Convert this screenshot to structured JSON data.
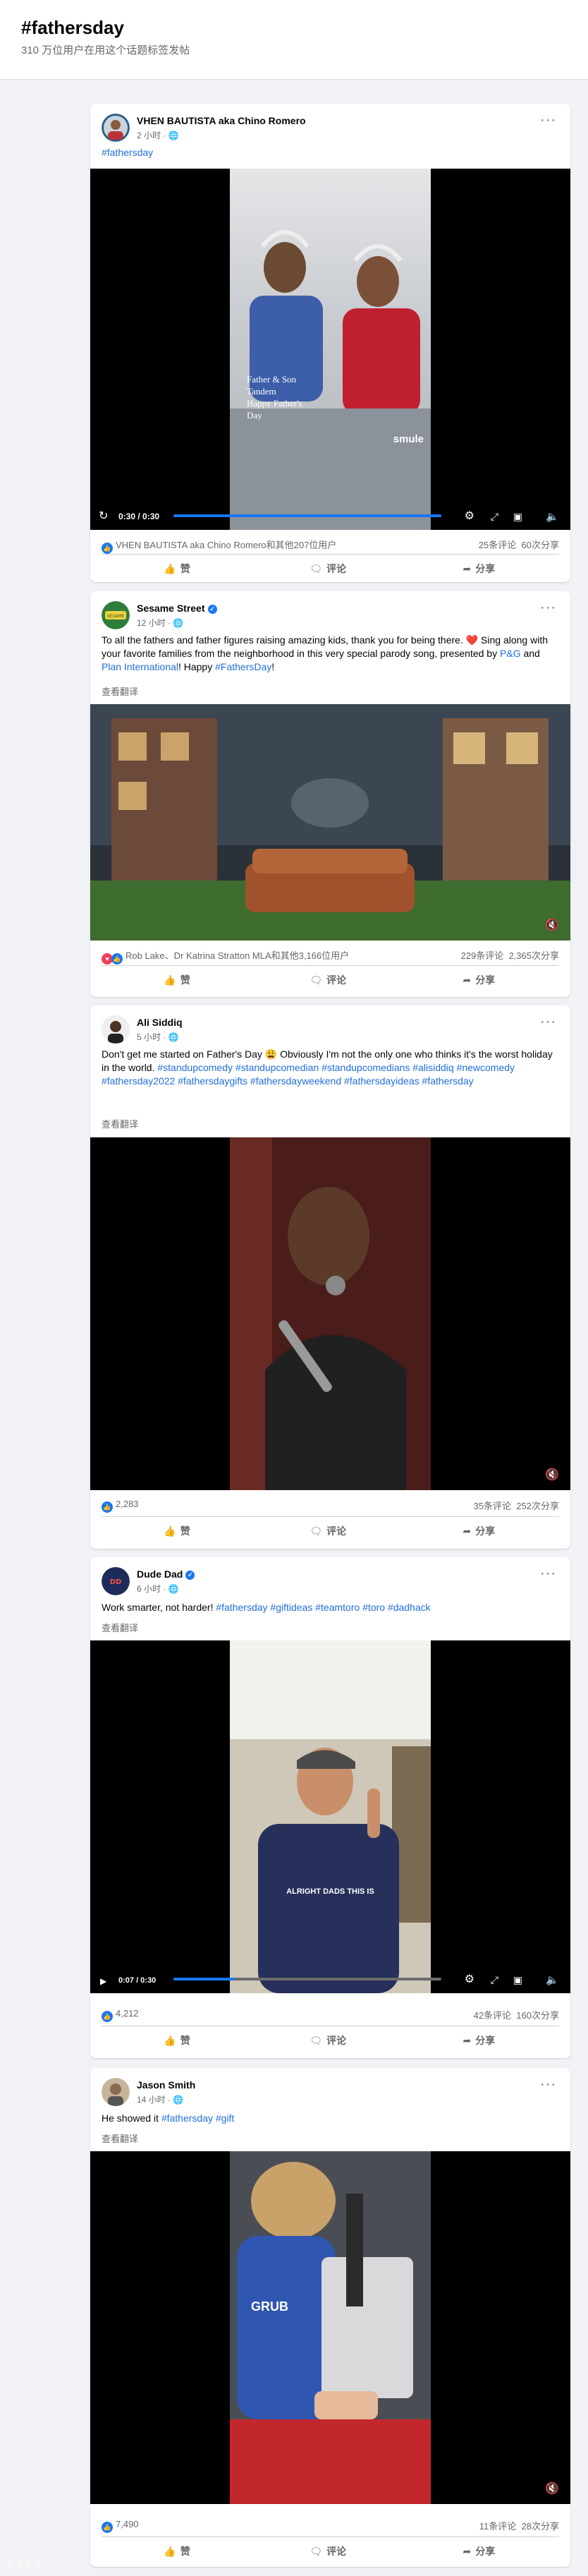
{
  "header": {
    "title": "#fathersday",
    "subtitle": "310 万位用户在用这个话题标签发帖"
  },
  "actions": {
    "like": "赞",
    "comment": "评论",
    "share": "分享"
  },
  "posts": [
    {
      "author": "VHEN BAUTISTA aka Chino Romero",
      "time": "2 小时",
      "text": "#fathersday",
      "video_overlay": [
        "Father & Son",
        "Tandem",
        "Happy Father's",
        "Day"
      ],
      "video_brand": "smule",
      "video_time": "0:30 / 0:30",
      "progress": 1.0,
      "reactions": "VHEN BAUTISTA aka Chino Romero和其他207位用户",
      "comments": "25条评论",
      "shares": "60次分享"
    },
    {
      "author": "Sesame Street",
      "time": "12 小时",
      "text_parts": [
        "To all the fathers and father figures raising amazing kids, thank you for being there. ❤️ Sing along with your favorite families from the neighborhood in this very special parody song, presented by ",
        "P&G",
        " and ",
        "Plan International",
        "! Happy ",
        "#FathersDay",
        "!"
      ],
      "translate": "查看翻译",
      "reactions": "Rob Lake、Dr Katrina Stratton MLA和其他3,166位用户",
      "comments": "229条评论",
      "shares": "2,365次分享"
    },
    {
      "author": "Ali Siddiq",
      "time": "5 小时",
      "text_parts": [
        "Don't get me started on Father's Day 😩 Obviously I'm not the only one who thinks it's the worst holiday in the world. ",
        "#standupcomedy #standupcomedian #standupcomedians #alisiddiq #newcomedy #fathersday2022 #fathersdaygifts #fathersdayweekend #fathersdayideas #fathersday"
      ],
      "translate": "查看翻译",
      "reactions": "2,283",
      "comments": "35条评论",
      "shares": "252次分享"
    },
    {
      "author": "Dude Dad",
      "time": "6 小时",
      "text_parts": [
        "Work smarter, not harder! ",
        "#fathersday #giftideas #teamtoro #toro #dadhack"
      ],
      "translate": "查看翻译",
      "video_caption": "ALRIGHT DADS THIS IS",
      "video_time": "0:07 / 0:30",
      "progress": 0.23,
      "reactions": "4,212",
      "comments": "42条评论",
      "shares": "160次分享"
    },
    {
      "author": "Jason Smith",
      "time": "14 小时",
      "text_parts": [
        "He showed it ",
        "#fathersday #gift"
      ],
      "translate": "查看翻译",
      "video_shirt": "GRUB",
      "reactions": "7,490",
      "comments": "11条评论",
      "shares": "28次分享"
    }
  ],
  "watermark": "新浪新闻"
}
